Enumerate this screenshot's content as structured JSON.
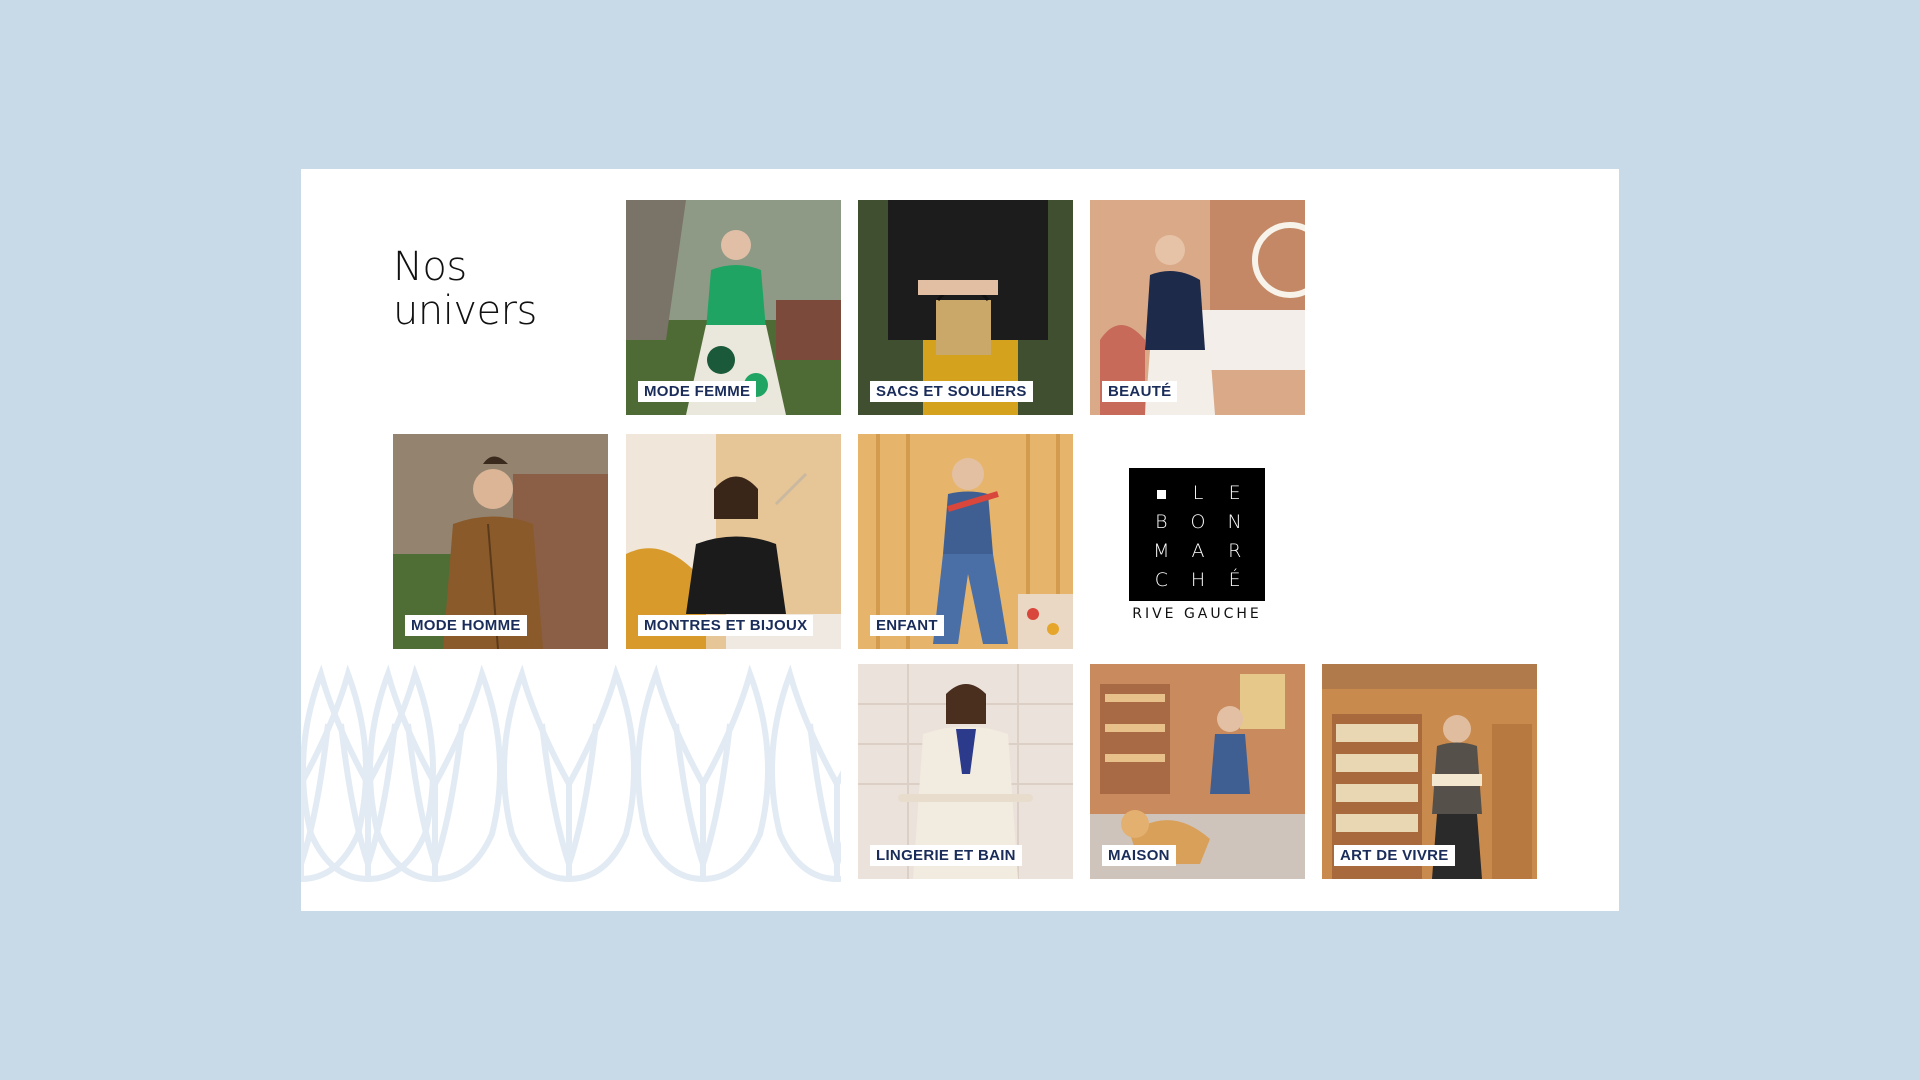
{
  "page": {
    "title_line1": "Nos",
    "title_line2": "univers"
  },
  "tiles": [
    {
      "label": "MODE FEMME",
      "bg": "#6f7d4e",
      "accent": "#1fa463"
    },
    {
      "label": "SACS ET SOULIERS",
      "bg": "#3b4a2c",
      "accent": "#1b1b1b"
    },
    {
      "label": "BEAUTÉ",
      "bg": "#d8a784",
      "accent": "#1e2a4a"
    },
    {
      "label": "MODE HOMME",
      "bg": "#7f6a55",
      "accent": "#8b5a2b"
    },
    {
      "label": "MONTRES ET BIJOUX",
      "bg": "#e0b98a",
      "accent": "#1b1b1b"
    },
    {
      "label": "ENFANT",
      "bg": "#e2b067",
      "accent": "#3f5f92"
    },
    {
      "label": "LINGERIE ET BAIN",
      "bg": "#ece3de",
      "accent": "#efe8dc"
    },
    {
      "label": "MAISON",
      "bg": "#c9875a",
      "accent": "#d9b56a"
    },
    {
      "label": "ART DE VIVRE",
      "bg": "#c98a4e",
      "accent": "#555049"
    }
  ],
  "logo": {
    "letters": [
      "",
      "L",
      "E",
      "B",
      "O",
      "N",
      "M",
      "A",
      "R",
      "C",
      "H",
      "É"
    ],
    "subtitle": "RIVE GAUCHE"
  },
  "colors": {
    "background": "#c8dae8",
    "panel": "#ffffff",
    "label_text": "#1a2c5a",
    "pattern": "#e6eef6"
  }
}
